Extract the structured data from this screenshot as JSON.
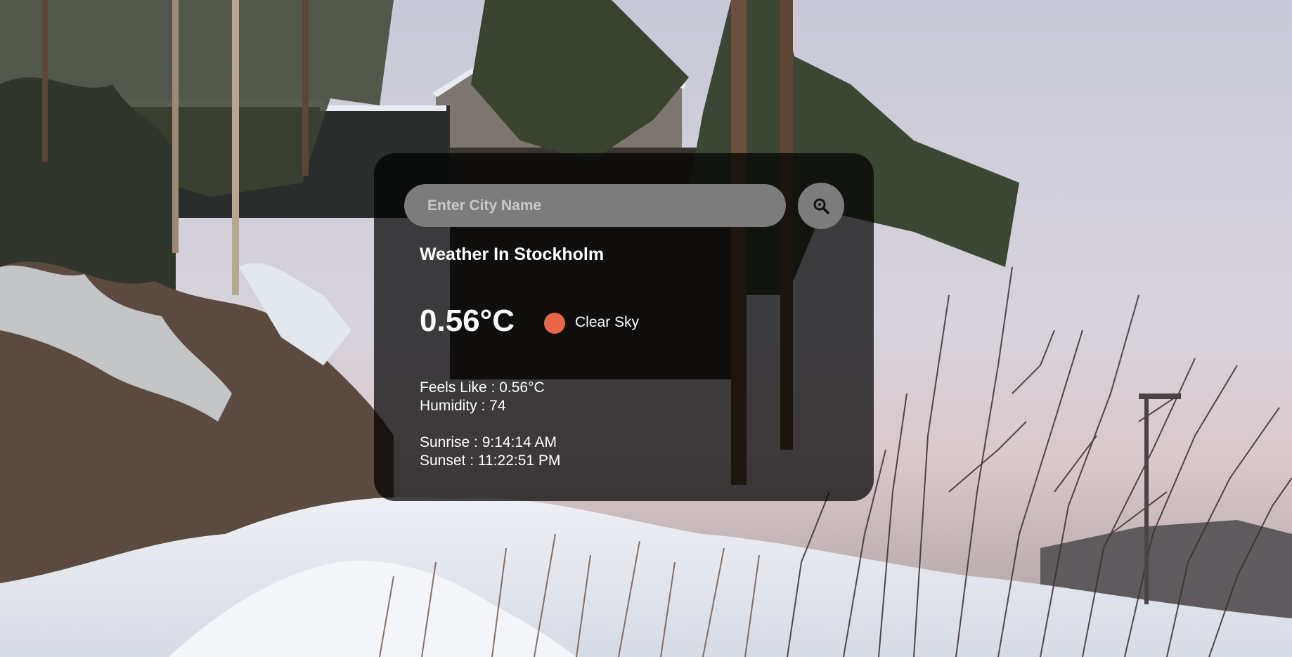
{
  "search": {
    "placeholder": "Enter City Name",
    "button_icon": "magnifier-icon"
  },
  "weather": {
    "title": "Weather In Stockholm",
    "temperature": "0.56°C",
    "condition_icon": "sun-dot-icon",
    "condition_icon_color": "#e8674a",
    "condition": "Clear Sky",
    "feels_like": "Feels Like : 0.56°C",
    "humidity": "Humidity : 74",
    "sunrise": "Sunrise : 9:14:14 AM",
    "sunset": "Sunset : 11:22:51 PM"
  },
  "background": {
    "description_icon": "winter-photo-background"
  }
}
